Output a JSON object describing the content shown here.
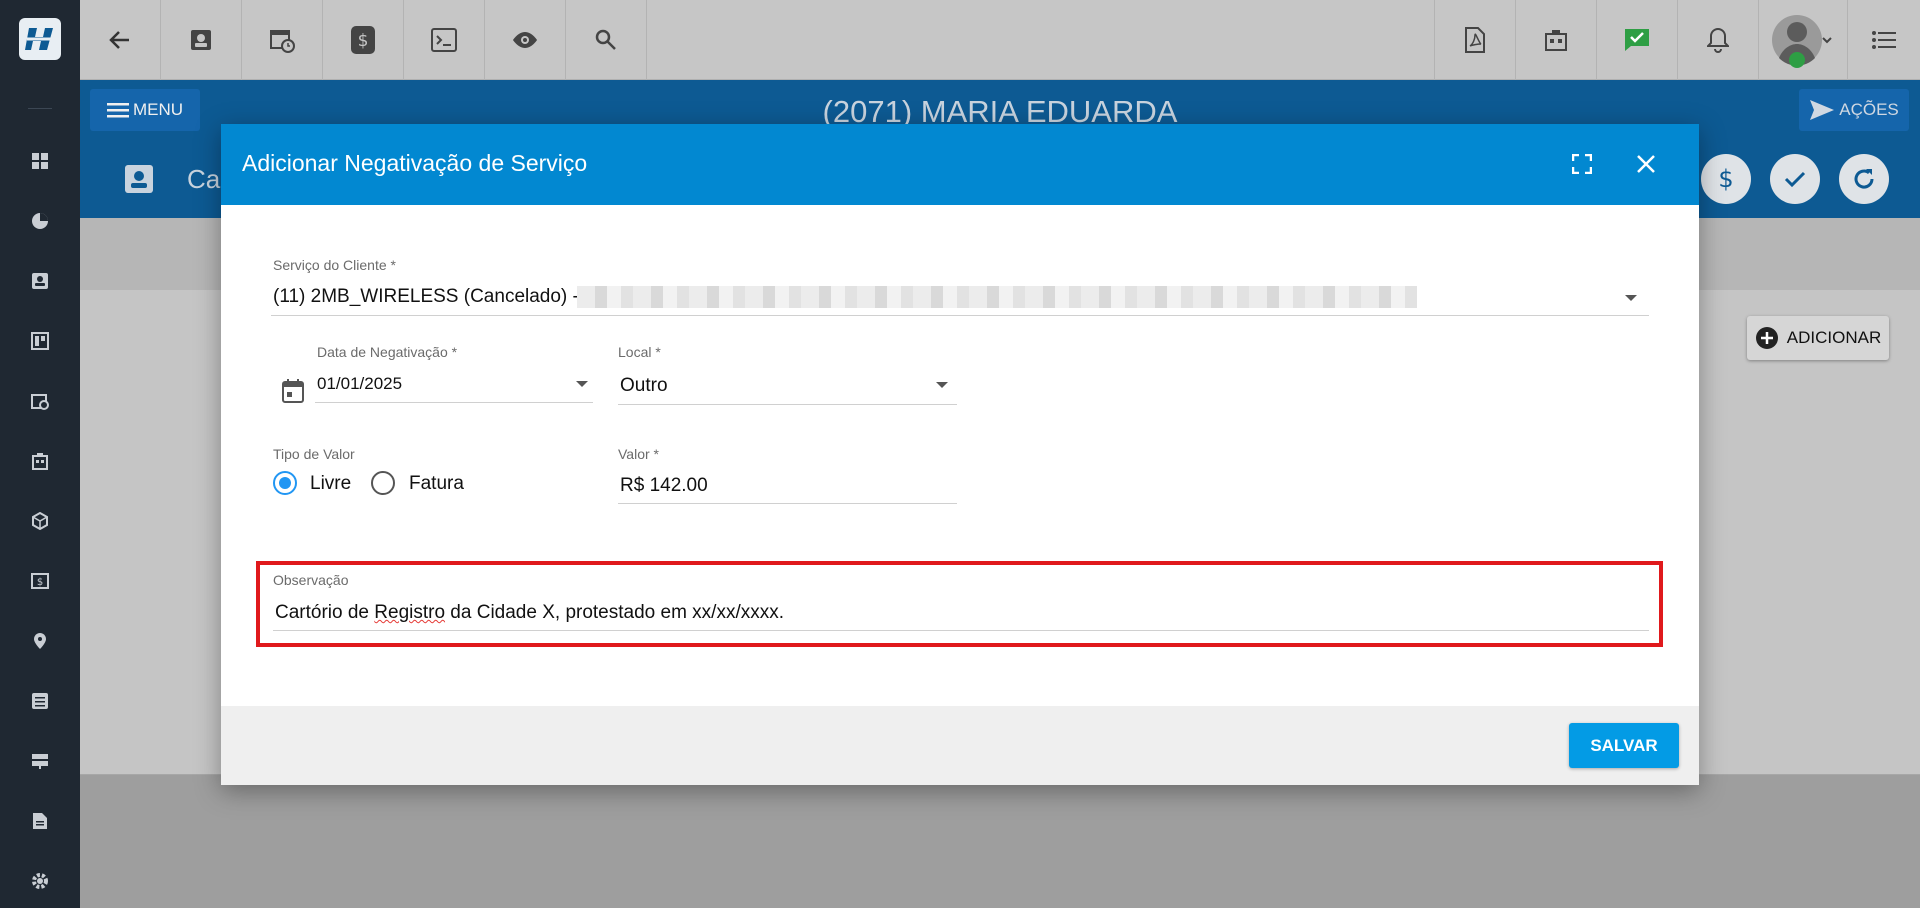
{
  "header": {
    "menu_label": "MENU",
    "client_title": "(2071) MARIA EDUARDA",
    "acoes_label": "AÇÕES",
    "section_label": "Cad"
  },
  "content": {
    "adicionar_label": "ADICIONAR"
  },
  "modal": {
    "title": "Adicionar Negativação de Serviço",
    "servico": {
      "label": "Serviço do Cliente",
      "value": "(11) 2MB_WIRELESS (Cancelado) -"
    },
    "data_negativacao": {
      "label": "Data de Negativação",
      "value": "01/01/2025"
    },
    "local": {
      "label": "Local",
      "value": "Outro"
    },
    "tipo_valor": {
      "label": "Tipo de Valor",
      "options": [
        "Livre",
        "Fatura"
      ],
      "selected": "Livre"
    },
    "valor": {
      "label": "Valor",
      "value": "R$ 142.00"
    },
    "observacao": {
      "label": "Observação",
      "value_before": "Cartório de ",
      "value_misspelled": "Registro",
      "value_after": " da Cidade X, protestado em xx/xx/xxxx."
    },
    "required_mark": "*",
    "save_label": "SALVAR"
  },
  "colors": {
    "modal_header": "#0288d1",
    "blue_bar": "#0d5a93",
    "sidebar": "#1f2832",
    "highlight": "#e0191c",
    "save_button": "#039be5",
    "radio_selected": "#2196f3",
    "status_green": "#2e9e44"
  }
}
